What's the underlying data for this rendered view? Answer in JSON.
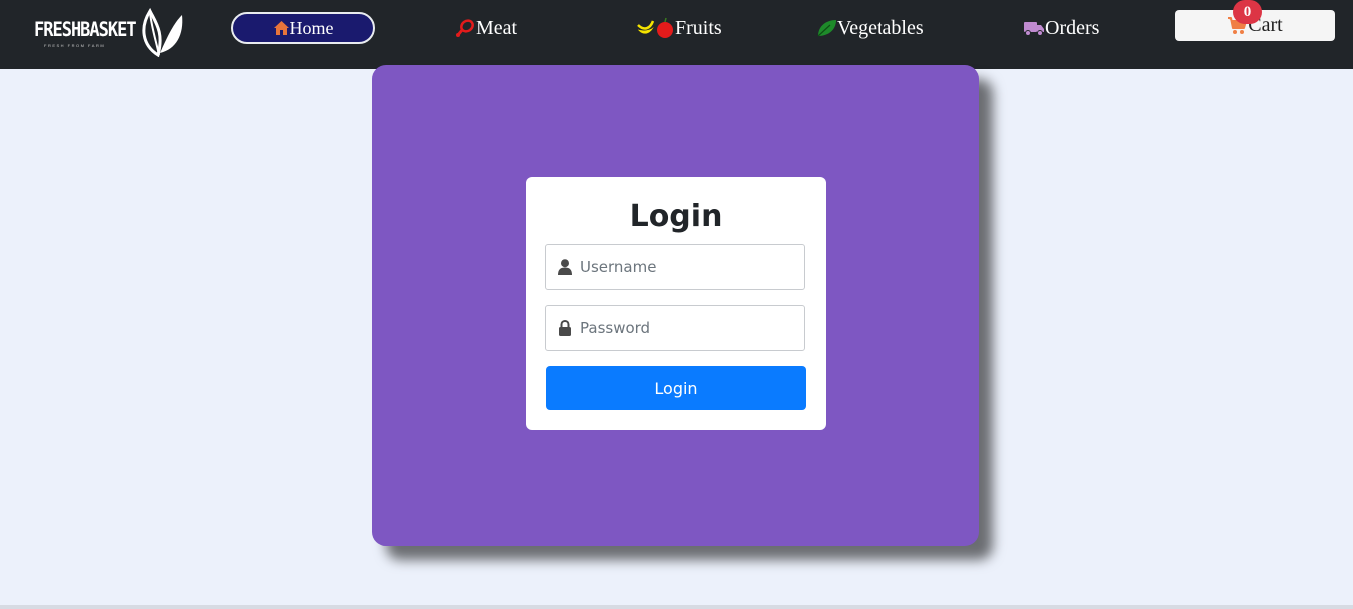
{
  "brand": {
    "name": "FRESHBASKET",
    "tagline": "FRESH FROM FARM"
  },
  "nav": {
    "items": [
      {
        "label": "Home",
        "icon": "home-icon"
      },
      {
        "label": "Meat",
        "icon": "meat-icon"
      },
      {
        "label": "Fruits",
        "icon": "fruits-icon"
      },
      {
        "label": "Vegetables",
        "icon": "leaf-icon"
      },
      {
        "label": "Orders",
        "icon": "truck-icon"
      }
    ],
    "cart": {
      "label": "Cart",
      "count": "0",
      "icon": "cart-icon"
    }
  },
  "login": {
    "title": "Login",
    "username_placeholder": "Username",
    "password_placeholder": "Password",
    "submit_label": "Login"
  },
  "colors": {
    "navbar": "#212529",
    "home_pill": "#1a1a6e",
    "panel": "#7e57c2",
    "primary_button": "#0a7bff",
    "badge": "#dc3545",
    "page_bg": "#ecf1fb"
  }
}
